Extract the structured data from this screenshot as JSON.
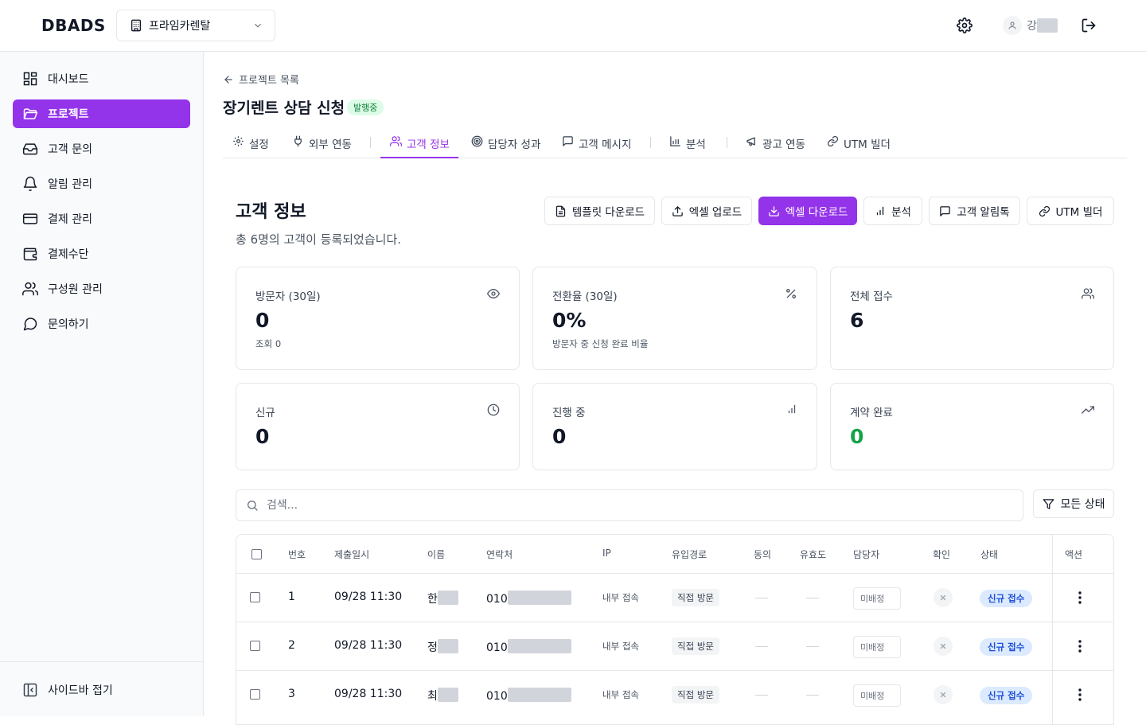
{
  "brand": {
    "logo": "DBADS"
  },
  "company_select": {
    "label": "프라임카렌탈"
  },
  "user": {
    "name_initial": "강"
  },
  "sidebar": {
    "items": [
      {
        "label": "대시보드",
        "icon": "dashboard-icon"
      },
      {
        "label": "프로젝트",
        "icon": "folder-icon",
        "active": true
      },
      {
        "label": "고객 문의",
        "icon": "inbox-icon"
      },
      {
        "label": "알림 관리",
        "icon": "bell-icon"
      },
      {
        "label": "결제 관리",
        "icon": "credit-card-icon"
      },
      {
        "label": "결제수단",
        "icon": "wallet-icon"
      },
      {
        "label": "구성원 관리",
        "icon": "users-icon"
      },
      {
        "label": "문의하기",
        "icon": "message-circle-icon"
      }
    ],
    "collapse_label": "사이드바 접기"
  },
  "breadcrumb": {
    "back_label": "프로젝트 목록"
  },
  "project": {
    "title": "장기렌트 상담 신청",
    "status_badge": "발행중"
  },
  "tabs": [
    {
      "label": "설정",
      "icon": "settings-icon"
    },
    {
      "label": "외부 연동",
      "icon": "plug-icon"
    },
    {
      "label": "고객 정보",
      "icon": "users-icon",
      "active": true
    },
    {
      "label": "담당자 성과",
      "icon": "target-icon"
    },
    {
      "label": "고객 메시지",
      "icon": "message-square-icon"
    },
    {
      "label": "분석",
      "icon": "chart-icon"
    },
    {
      "label": "광고 연동",
      "icon": "megaphone-icon"
    },
    {
      "label": "UTM 빌더",
      "icon": "link-icon"
    }
  ],
  "section": {
    "title": "고객 정보",
    "subtitle": "총 6명의 고객이 등록되었습니다."
  },
  "actions": [
    {
      "label": "템플릿 다운로드",
      "icon": "file-icon"
    },
    {
      "label": "엑셀 업로드",
      "icon": "upload-icon"
    },
    {
      "label": "엑셀 다운로드",
      "icon": "download-icon",
      "primary": true
    },
    {
      "label": "분석",
      "icon": "chart-icon"
    },
    {
      "label": "고객 알림톡",
      "icon": "message-square-icon"
    },
    {
      "label": "UTM 빌더",
      "icon": "link-icon"
    }
  ],
  "stats": [
    {
      "title": "방문자 (30일)",
      "value": "0",
      "sub": "조회 0",
      "icon": "eye-icon"
    },
    {
      "title": "전환율 (30일)",
      "value": "0%",
      "sub": "방문자 중 신청 완료 비율",
      "icon": "percent-icon"
    },
    {
      "title": "전체 접수",
      "value": "6",
      "sub": "",
      "icon": "users-icon"
    },
    {
      "title": "신규",
      "value": "0",
      "sub": "",
      "icon": "clock-icon"
    },
    {
      "title": "진행 중",
      "value": "0",
      "sub": "",
      "icon": "bar-chart-icon"
    },
    {
      "title": "계약 완료",
      "value": "0",
      "sub": "",
      "icon": "trending-up-icon",
      "color": "#16a34a"
    }
  ],
  "search": {
    "placeholder": "검색..."
  },
  "filter": {
    "label": "모든 상태"
  },
  "table": {
    "columns": [
      "번호",
      "제출일시",
      "이름",
      "연락처",
      "IP",
      "유입경로",
      "동의",
      "유효도",
      "담당자",
      "확인",
      "상태",
      "액션"
    ],
    "rows": [
      {
        "no": "1",
        "date": "09/28 11:30",
        "name_initial": "한",
        "phone_prefix": "010",
        "ip": "내부 접속",
        "source": "직접 방문",
        "assignee": "미배정",
        "status": "신규 접수"
      },
      {
        "no": "2",
        "date": "09/28 11:30",
        "name_initial": "정",
        "phone_prefix": "010",
        "ip": "내부 접속",
        "source": "직접 방문",
        "assignee": "미배정",
        "status": "신규 접수"
      },
      {
        "no": "3",
        "date": "09/28 11:30",
        "name_initial": "최",
        "phone_prefix": "010",
        "ip": "내부 접속",
        "source": "직접 방문",
        "assignee": "미배정",
        "status": "신규 접수"
      }
    ]
  },
  "colors": {
    "accent": "#9333ea",
    "success": "#16a34a",
    "status_bg": "#dbeafe",
    "status_fg": "#1d4ed8"
  }
}
